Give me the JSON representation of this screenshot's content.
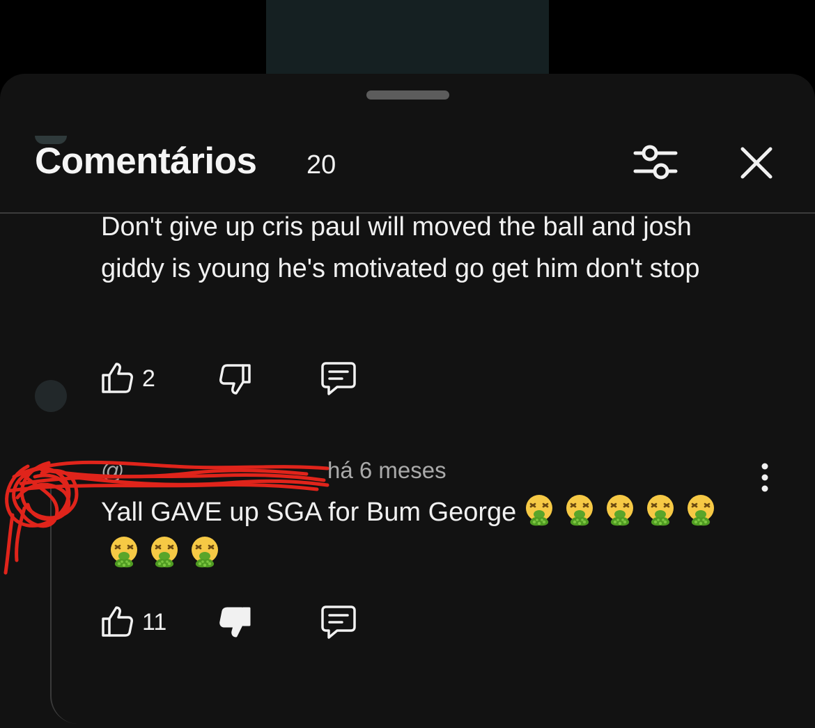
{
  "sheet": {
    "title": "Comentários",
    "count": "20",
    "filter_icon": "sliders-icon",
    "close_icon": "close-icon"
  },
  "comments": [
    {
      "text": "Don't give up cris paul will moved the ball and josh giddy is young he's motivated go get him don't stop",
      "likes": "2",
      "icons": [
        "thumb-up-icon",
        "thumb-down-icon",
        "reply-icon"
      ]
    },
    {
      "author": "@",
      "time": "há 6 meses",
      "text": "Yall GAVE up SGA for Bum George",
      "emoji_count": 8,
      "emoji_name": "vomiting-face-emoji",
      "likes": "11",
      "icons": [
        "thumb-up-icon",
        "thumb-down-filled-icon",
        "reply-icon",
        "more-vert-icon"
      ]
    }
  ],
  "colors": {
    "sheet_bg": "#121212",
    "text": "#f1f1f1",
    "secondary_text": "#aaaaaa",
    "scribble": "#e0241b"
  }
}
